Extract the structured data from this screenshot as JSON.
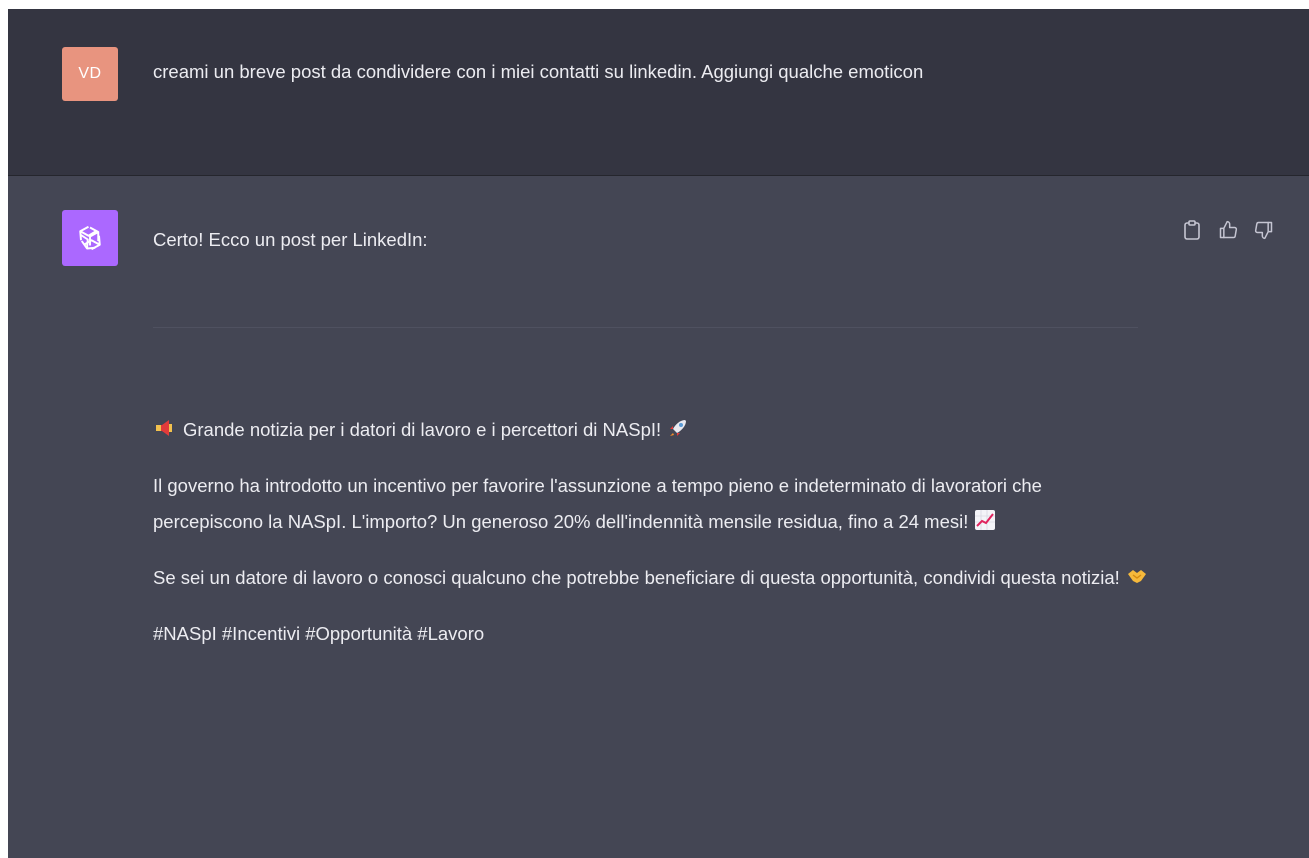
{
  "user_message": {
    "avatar_initials": "VD",
    "avatar_color": "#e8947f",
    "text": "creami un breve post da condividere con i miei contatti su linkedin. Aggiungi qualche emoticon"
  },
  "assistant_message": {
    "avatar_icon": "openai-logo-icon",
    "avatar_color": "#ab68ff",
    "intro": "Certo! Ecco un post per LinkedIn:",
    "actions": [
      "copy-icon",
      "thumbs-up-icon",
      "thumbs-down-icon"
    ],
    "post": {
      "headline": "Grande notizia per i datori di lavoro e i percettori di NASpI!",
      "headline_emoji_start": "megaphone-icon",
      "headline_emoji_end": "rocket-icon",
      "paragraph_1": "Il governo ha introdotto un incentivo per favorire l'assunzione a tempo pieno e indeterminato di lavoratori che percepiscono la NASpI. L'importo? Un generoso 20% dell'indennità mensile residua, fino a 24 mesi!",
      "paragraph_1_emoji": "chart-increasing-icon",
      "paragraph_2": "Se sei un datore di lavoro o conosci qualcuno che potrebbe beneficiare di questa opportunità, condividi questa notizia!",
      "paragraph_2_emoji": "handshake-icon",
      "hashtags": "#NASpI #Incentivi #Opportunità #Lavoro"
    }
  },
  "colors": {
    "user_background": "#343541",
    "assistant_background": "#444654",
    "text": "#ececf1"
  }
}
